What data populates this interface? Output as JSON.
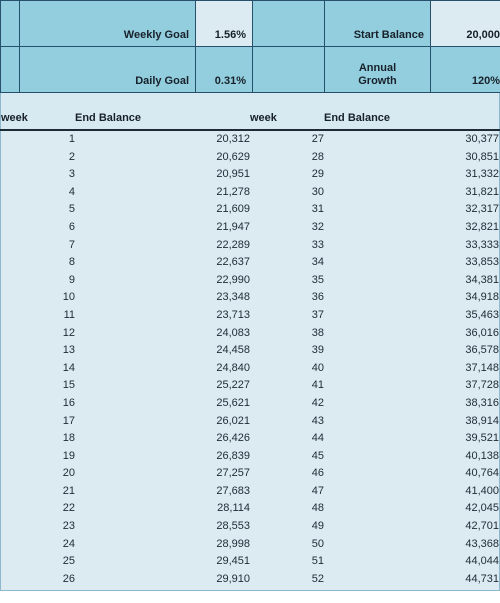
{
  "params": {
    "rows": [
      {
        "label_left": "Weekly Goal",
        "value_left": "1.56%",
        "label_right": "Start Balance",
        "value_right": "20,000",
        "value_left_highlight": true,
        "value_right_highlight": true
      },
      {
        "label_left": "Daily Goal",
        "value_left": "0.31%",
        "label_right": "Annual Growth",
        "label_right_line1": "Annual",
        "label_right_line2": "Growth",
        "value_right": "120%",
        "value_left_highlight": false,
        "value_right_highlight": false
      }
    ]
  },
  "table": {
    "headers": {
      "week_left": "week",
      "balance_left": "End Balance",
      "week_right": "week",
      "balance_right": "End Balance"
    },
    "rows": [
      {
        "week_left": "1",
        "balance_left": "20,312",
        "week_right": "27",
        "balance_right": "30,377"
      },
      {
        "week_left": "2",
        "balance_left": "20,629",
        "week_right": "28",
        "balance_right": "30,851"
      },
      {
        "week_left": "3",
        "balance_left": "20,951",
        "week_right": "29",
        "balance_right": "31,332"
      },
      {
        "week_left": "4",
        "balance_left": "21,278",
        "week_right": "30",
        "balance_right": "31,821"
      },
      {
        "week_left": "5",
        "balance_left": "21,609",
        "week_right": "31",
        "balance_right": "32,317"
      },
      {
        "week_left": "6",
        "balance_left": "21,947",
        "week_right": "32",
        "balance_right": "32,821"
      },
      {
        "week_left": "7",
        "balance_left": "22,289",
        "week_right": "33",
        "balance_right": "33,333"
      },
      {
        "week_left": "8",
        "balance_left": "22,637",
        "week_right": "34",
        "balance_right": "33,853"
      },
      {
        "week_left": "9",
        "balance_left": "22,990",
        "week_right": "35",
        "balance_right": "34,381"
      },
      {
        "week_left": "10",
        "balance_left": "23,348",
        "week_right": "36",
        "balance_right": "34,918"
      },
      {
        "week_left": "11",
        "balance_left": "23,713",
        "week_right": "37",
        "balance_right": "35,463"
      },
      {
        "week_left": "12",
        "balance_left": "24,083",
        "week_right": "38",
        "balance_right": "36,016"
      },
      {
        "week_left": "13",
        "balance_left": "24,458",
        "week_right": "39",
        "balance_right": "36,578"
      },
      {
        "week_left": "14",
        "balance_left": "24,840",
        "week_right": "40",
        "balance_right": "37,148"
      },
      {
        "week_left": "15",
        "balance_left": "25,227",
        "week_right": "41",
        "balance_right": "37,728"
      },
      {
        "week_left": "16",
        "balance_left": "25,621",
        "week_right": "42",
        "balance_right": "38,316"
      },
      {
        "week_left": "17",
        "balance_left": "26,021",
        "week_right": "43",
        "balance_right": "38,914"
      },
      {
        "week_left": "18",
        "balance_left": "26,426",
        "week_right": "44",
        "balance_right": "39,521"
      },
      {
        "week_left": "19",
        "balance_left": "26,839",
        "week_right": "45",
        "balance_right": "40,138"
      },
      {
        "week_left": "20",
        "balance_left": "27,257",
        "week_right": "46",
        "balance_right": "40,764"
      },
      {
        "week_left": "21",
        "balance_left": "27,683",
        "week_right": "47",
        "balance_right": "41,400"
      },
      {
        "week_left": "22",
        "balance_left": "28,114",
        "week_right": "48",
        "balance_right": "42,045"
      },
      {
        "week_left": "23",
        "balance_left": "28,553",
        "week_right": "49",
        "balance_right": "42,701"
      },
      {
        "week_left": "24",
        "balance_left": "28,998",
        "week_right": "50",
        "balance_right": "43,368"
      },
      {
        "week_left": "25",
        "balance_left": "29,451",
        "week_right": "51",
        "balance_right": "44,044"
      },
      {
        "week_left": "26",
        "balance_left": "29,910",
        "week_right": "52",
        "balance_right": "44,731"
      }
    ]
  },
  "colors": {
    "header_fill": "#92cedd",
    "value_fill": "#dcebf2",
    "body_fill": "#dcebf2",
    "grid_line": "#26506b",
    "text": "#18212b"
  }
}
